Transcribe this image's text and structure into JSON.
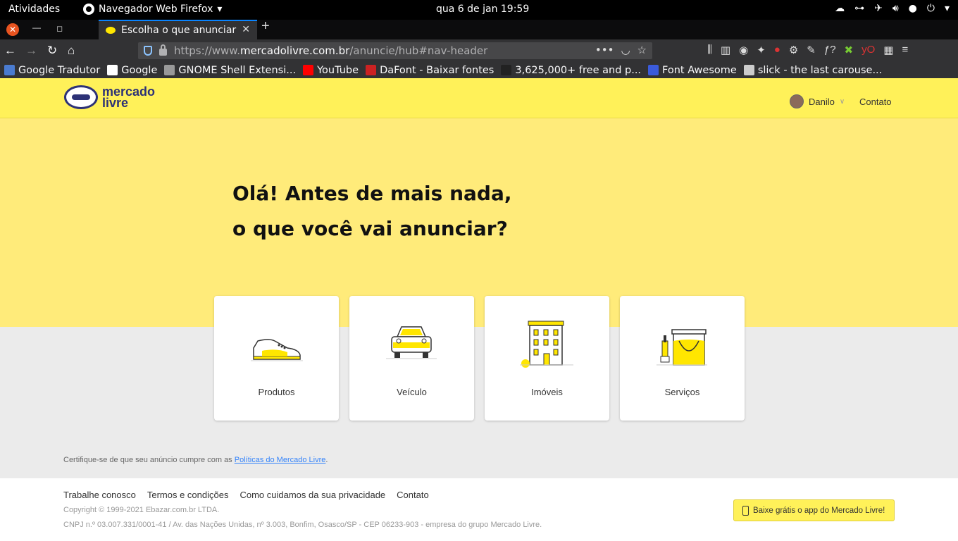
{
  "system_bar": {
    "activities": "Atividades",
    "app_name": "Navegador Web Firefox",
    "clock": "qua 6 de jan  19:59"
  },
  "browser": {
    "tab_title": "Escolha o que anunciar",
    "url_prefix": "https://www.",
    "url_domain": "mercadolivre.com.br",
    "url_path": "/anuncie/hub#nav-header",
    "bookmarks": [
      {
        "label": "Google Tradutor",
        "icon": "google-translate-icon",
        "color": "#4a7bd0"
      },
      {
        "label": "Google",
        "icon": "google-icon",
        "color": "#ffffff"
      },
      {
        "label": "GNOME Shell Extensi...",
        "icon": "gnome-icon",
        "color": "#999999"
      },
      {
        "label": "YouTube",
        "icon": "youtube-icon",
        "color": "#ff0000"
      },
      {
        "label": "DaFont - Baixar fontes",
        "icon": "dafont-icon",
        "color": "#cc2222"
      },
      {
        "label": "3,625,000+ free and p...",
        "icon": "freepik-icon",
        "color": "#222222"
      },
      {
        "label": "Font Awesome",
        "icon": "font-awesome-icon",
        "color": "#3b5bdb"
      },
      {
        "label": "slick - the last carouse...",
        "icon": "globe-icon",
        "color": "#cccccc"
      }
    ]
  },
  "header": {
    "logo_line1": "mercado",
    "logo_line2": "livre",
    "user_name": "Danilo",
    "contact": "Contato"
  },
  "hero": {
    "title_line1": "Olá! Antes de mais nada,",
    "title_line2": "o que você vai anunciar?"
  },
  "categories": [
    {
      "label": "Produtos",
      "icon": "sneaker-icon"
    },
    {
      "label": "Veículo",
      "icon": "car-icon"
    },
    {
      "label": "Imóveis",
      "icon": "building-icon"
    },
    {
      "label": "Serviços",
      "icon": "paint-bucket-icon"
    }
  ],
  "notice": {
    "text": "Certifique-se de que seu anúncio cumpre com as ",
    "link": "Políticas do Mercado Livre",
    "suffix": "."
  },
  "footer": {
    "links": [
      "Trabalhe conosco",
      "Termos e condições",
      "Como cuidamos da sua privacidade",
      "Contato"
    ],
    "copyright": "Copyright © 1999-2021 Ebazar.com.br LTDA.",
    "cnpj": "CNPJ n.º 03.007.331/0001-41 / Av. das Nações Unidas, nº 3.003, Bonfim, Osasco/SP - CEP 06233-903 - empresa do grupo Mercado Livre.",
    "app_banner": "Baixe grátis o app do Mercado Livre!"
  },
  "colors": {
    "brand_yellow": "#fff159",
    "hero_yellow": "#ffeb7a",
    "brand_blue": "#2d3277",
    "link_blue": "#3483fa"
  }
}
